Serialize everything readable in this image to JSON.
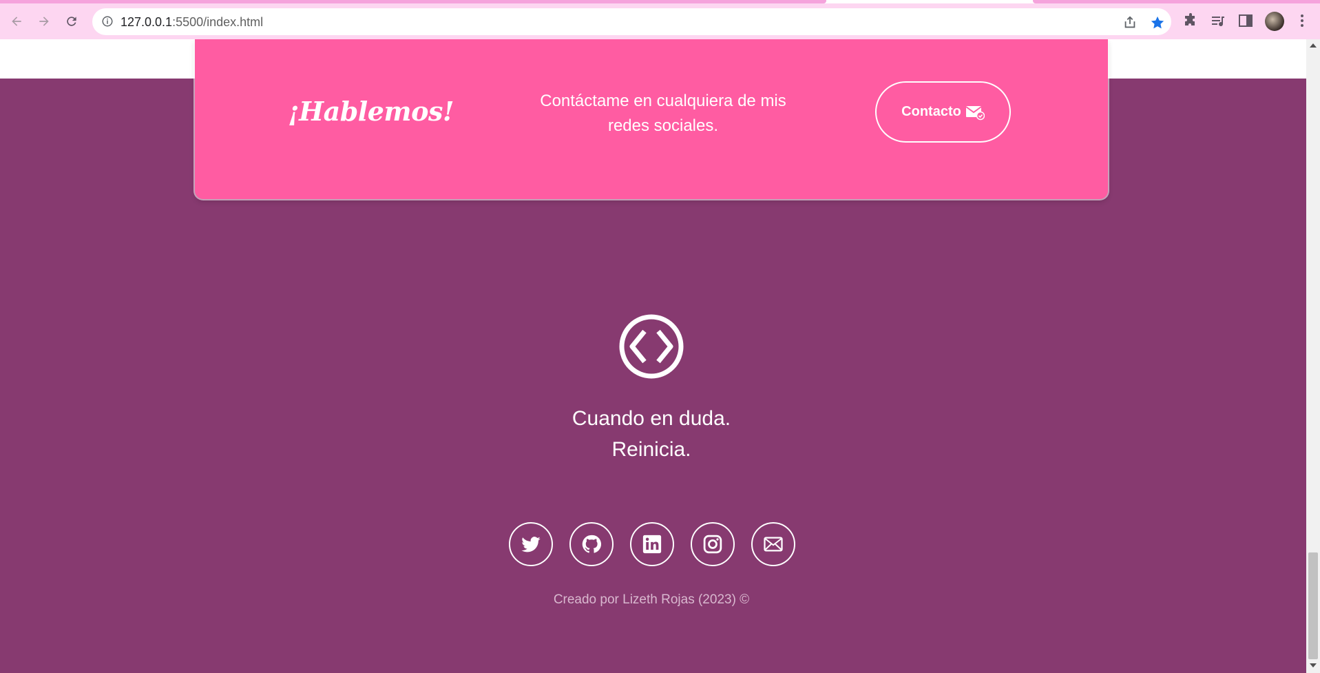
{
  "browser": {
    "url_host": "127.0.0.1",
    "url_rest": ":5500/index.html"
  },
  "cta": {
    "title": "¡Hablemos!",
    "text": "Contáctame en cualquiera de mis redes sociales.",
    "button_label": "Contacto"
  },
  "footer": {
    "quote_line1": "Cuando en duda.",
    "quote_line2": "Reinicia.",
    "credit": "Creado por Lizeth Rojas (2023) ©",
    "socials": [
      "twitter-icon",
      "github-icon",
      "linkedin-icon",
      "instagram-icon",
      "email-icon"
    ]
  },
  "colors": {
    "footer_bg": "#873a70",
    "cta_bg": "#ff5ca2",
    "chrome_bg": "#fdd6f1"
  }
}
